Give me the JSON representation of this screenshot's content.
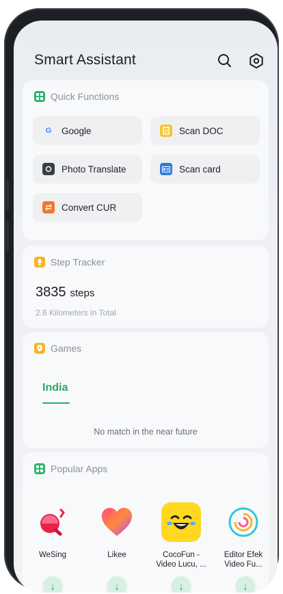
{
  "header": {
    "title": "Smart Assistant",
    "search_icon": "search-icon",
    "settings_icon": "settings-gear-icon"
  },
  "quick_functions": {
    "title": "Quick Functions",
    "items": [
      {
        "label": "Google",
        "icon": "google-icon"
      },
      {
        "label": "Scan DOC",
        "icon": "scan-doc-icon"
      },
      {
        "label": "Photo Translate",
        "icon": "photo-translate-icon"
      },
      {
        "label": "Scan card",
        "icon": "scan-card-icon"
      },
      {
        "label": "Convert CUR",
        "icon": "convert-currency-icon"
      }
    ]
  },
  "step_tracker": {
    "title": "Step Tracker",
    "steps": "3835",
    "steps_unit": "steps",
    "distance_text": "2.6 Kilometers in Total"
  },
  "games": {
    "title": "Games",
    "tab": "India",
    "empty_text": "No match in the near future"
  },
  "popular_apps": {
    "title": "Popular Apps",
    "apps": [
      {
        "name": "WeSing",
        "icon": "wesing-icon"
      },
      {
        "name": "Likee",
        "icon": "likee-heart-icon"
      },
      {
        "name": "CocoFun - Video Lucu, ...",
        "icon": "cocofun-laugh-icon"
      },
      {
        "name": "Editor Efek Video Fu...",
        "icon": "editor-swirl-icon"
      }
    ]
  },
  "colors": {
    "accent_green": "#2aa86a",
    "download_bg": "#d8f0e3"
  }
}
